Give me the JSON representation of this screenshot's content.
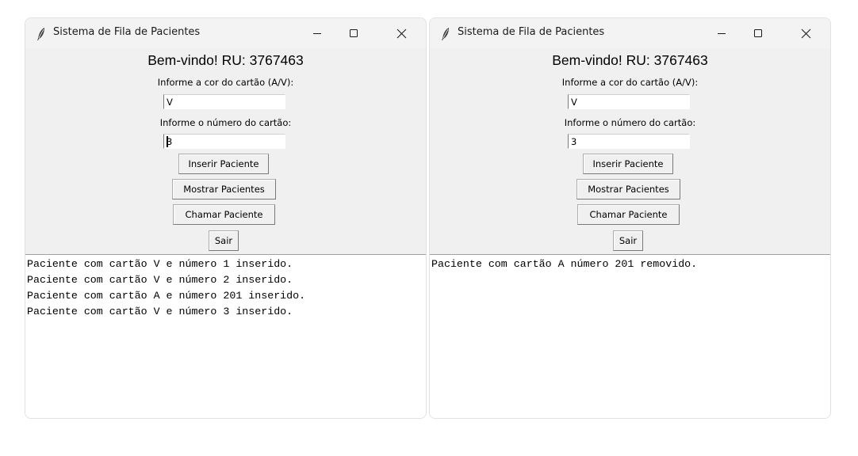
{
  "windows": [
    {
      "title": "Sistema de Fila de Pacientes",
      "welcome": "Bem-vindo! RU: 3767463",
      "label_cor": "Informe a cor do cartão (A/V):",
      "entry_cor_value": "V",
      "label_numero": "Informe o número do cartão:",
      "entry_numero_value": "3",
      "buttons": {
        "inserir": "Inserir Paciente",
        "mostrar": "Mostrar Pacientes",
        "chamar": "Chamar Paciente",
        "sair": "Sair"
      },
      "log": [
        "Paciente com cartão V e número 1 inserido.",
        "Paciente com cartão V e número 2 inserido.",
        "Paciente com cartão A e número 201 inserido.",
        "Paciente com cartão V e número 3 inserido."
      ]
    },
    {
      "title": "Sistema de Fila de Pacientes",
      "welcome": "Bem-vindo! RU: 3767463",
      "label_cor": "Informe a cor do cartão (A/V):",
      "entry_cor_value": "V",
      "label_numero": "Informe o número do cartão:",
      "entry_numero_value": "3",
      "buttons": {
        "inserir": "Inserir Paciente",
        "mostrar": "Mostrar Pacientes",
        "chamar": "Chamar Paciente",
        "sair": "Sair"
      },
      "log": [
        "Paciente com cartão A número 201 removido."
      ]
    }
  ],
  "icons": {
    "app": "feather-icon",
    "minimize": "minimize-icon",
    "maximize": "maximize-icon",
    "close": "close-icon"
  }
}
